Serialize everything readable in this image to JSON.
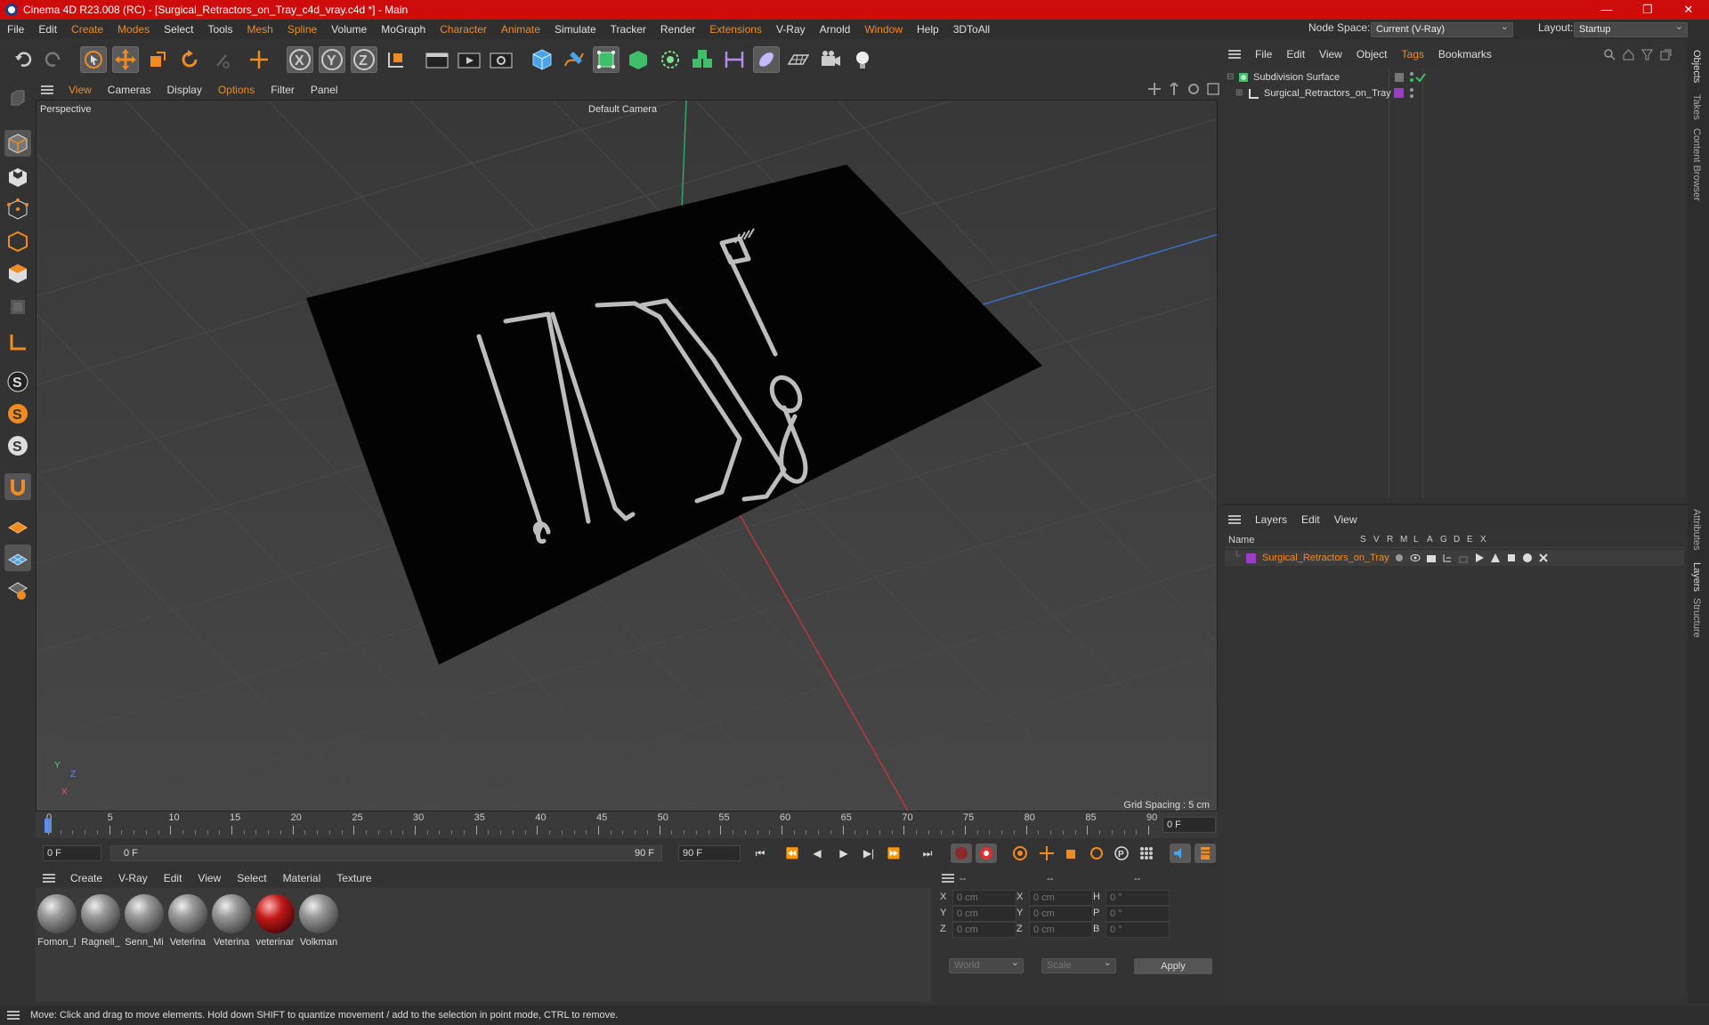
{
  "titlebar": {
    "title": "Cinema 4D R23.008 (RC) - [Surgical_Retractors_on_Tray_c4d_vray.c4d *] - Main",
    "minimize": "—",
    "restore": "❐",
    "close": "✕"
  },
  "menubar": {
    "items": [
      "File",
      "Edit",
      "Create",
      "Modes",
      "Select",
      "Tools",
      "Mesh",
      "Spline",
      "Volume",
      "MoGraph",
      "Character",
      "Animate",
      "Simulate",
      "Tracker",
      "Render",
      "Extensions",
      "V-Ray",
      "Arnold",
      "Window",
      "Help",
      "3DToAll"
    ],
    "node_space_label": "Node Space:",
    "node_space_value": "Current (V-Ray)",
    "layout_label": "Layout:",
    "layout_value": "Startup"
  },
  "viewport": {
    "menu": [
      "View",
      "Cameras",
      "Display",
      "Options",
      "Filter",
      "Panel"
    ],
    "name": "Perspective",
    "camera": "Default Camera",
    "grid_spacing": "Grid Spacing : 5 cm",
    "axis_y": "Y",
    "axis_z": "Z",
    "axis_x": "X"
  },
  "timeline": {
    "ticks": [
      "0",
      "5",
      "10",
      "15",
      "20",
      "25",
      "30",
      "35",
      "40",
      "45",
      "50",
      "55",
      "60",
      "65",
      "70",
      "75",
      "80",
      "85",
      "90"
    ],
    "current_frame": "0 F"
  },
  "transport": {
    "start": "0 F",
    "range_start": "0 F",
    "range_end": "90 F",
    "end": "90 F"
  },
  "materials": {
    "menu": [
      "Create",
      "V-Ray",
      "Edit",
      "View",
      "Select",
      "Material",
      "Texture"
    ],
    "items": [
      {
        "name": "Fomon_I",
        "red": false
      },
      {
        "name": "Ragnell_",
        "red": false
      },
      {
        "name": "Senn_Mi",
        "red": false
      },
      {
        "name": "Veterina",
        "red": false
      },
      {
        "name": "Veterina",
        "red": false
      },
      {
        "name": "veterinar",
        "red": true
      },
      {
        "name": "Volkman",
        "red": false
      }
    ]
  },
  "coords": {
    "headers": [
      "--",
      "--",
      "--"
    ],
    "rows": [
      {
        "a": "X",
        "av": "0 cm",
        "b": "X",
        "bv": "0 cm",
        "c": "H",
        "cv": "0 °"
      },
      {
        "a": "Y",
        "av": "0 cm",
        "b": "Y",
        "bv": "0 cm",
        "c": "P",
        "cv": "0 °"
      },
      {
        "a": "Z",
        "av": "0 cm",
        "b": "Z",
        "bv": "0 cm",
        "c": "B",
        "cv": "0 °"
      }
    ],
    "world": "World",
    "scale": "Scale",
    "apply": "Apply"
  },
  "objects": {
    "menu": [
      "File",
      "Edit",
      "View",
      "Object",
      "Tags",
      "Bookmarks"
    ],
    "tree": [
      "Subdivision Surface",
      "Surgical_Retractors_on_Tray"
    ]
  },
  "layers": {
    "menu": [
      "Layers",
      "Edit",
      "View"
    ],
    "columns": [
      "Name",
      "S",
      "V",
      "R",
      "M",
      "L",
      "A",
      "G",
      "D",
      "E",
      "X"
    ],
    "rows": [
      "Surgical_Retractors_on_Tray"
    ],
    "layer_color": "#9a3fc4"
  },
  "side_tabs": [
    "Objects",
    "Takes",
    "Content Browser",
    "Attributes",
    "Layers",
    "Structure"
  ],
  "status": "Move: Click and drag to move elements. Hold down SHIFT to quantize movement / add to the selection in point mode, CTRL to remove.",
  "colors": {
    "accent": "#f08a23",
    "title_red": "#cf0c0c",
    "playhead": "#5b8de0"
  }
}
